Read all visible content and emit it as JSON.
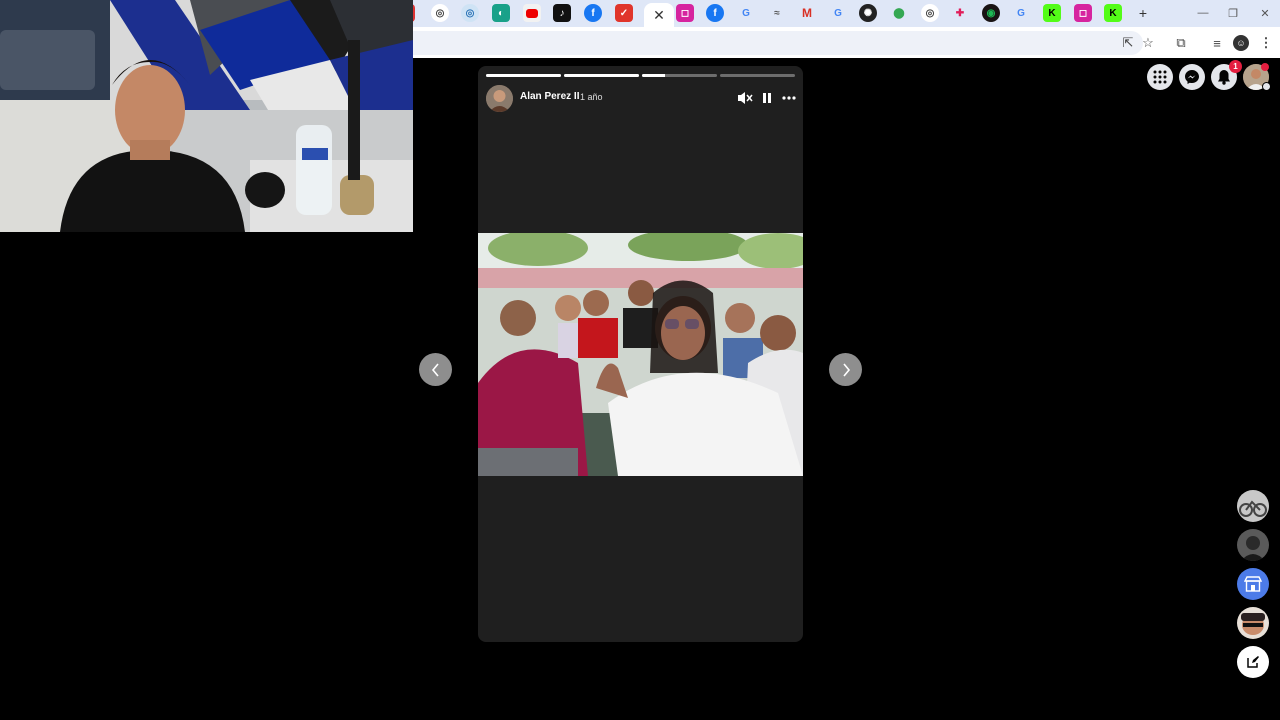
{
  "story": {
    "author_name": "Alan Perez II",
    "time_ago": "1 año",
    "progress": [
      1,
      1,
      0.3,
      0,
      0
    ]
  },
  "icons": {
    "tabs": [
      "tab-favicon-icon",
      "chrome-icon",
      "edge-icon",
      "app-icon",
      "youtube-icon",
      "tiktok-icon",
      "facebook-icon",
      "tab-favicon-icon",
      "close-icon",
      "instagram-icon",
      "facebook-icon",
      "google-icon",
      "tab-favicon-icon",
      "gmail-icon",
      "google-icon",
      "openai-icon",
      "maps-icon",
      "chrome-icon",
      "slack-icon",
      "spotify-icon",
      "google-icon",
      "kick-icon",
      "instagram-icon",
      "kick-icon",
      "new-tab-icon"
    ],
    "toolbar": [
      "install-app-icon",
      "star-icon",
      "extensions-icon",
      "media-control-icon",
      "profile-icon",
      "more-icon"
    ],
    "header": [
      "menu-grid-icon",
      "messenger-icon",
      "notifications-icon",
      "account-avatar"
    ]
  },
  "notifications": {
    "badge": "1"
  }
}
